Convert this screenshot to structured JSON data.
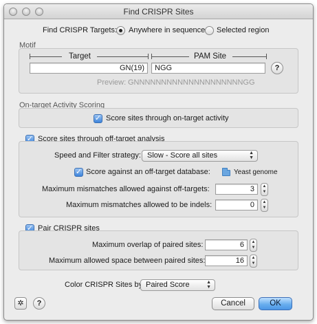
{
  "window": {
    "title": "Find CRISPR Sites"
  },
  "targets": {
    "label": "Find CRISPR Targets:",
    "option_anywhere": "Anywhere in sequence",
    "option_selected": "Selected region",
    "selected": "anywhere"
  },
  "motif": {
    "legend": "Motif",
    "target_header": "Target",
    "pam_header": "PAM Site",
    "target_value": "GN(19)",
    "pam_value": "NGG",
    "preview_label": "Preview:",
    "preview_value": "GNNNNNNNNNNNNNNNNNNNNGG"
  },
  "on_target": {
    "legend": "On-target Activity Scoring",
    "checkbox_label": "Score sites through on-target activity",
    "checked": true
  },
  "off_target": {
    "checkbox_label": "Score sites through off-target analysis",
    "checked": true,
    "strategy_label": "Speed and Filter strategy:",
    "strategy_value": "Slow - Score all sites",
    "database_label": "Score against an off-target database:",
    "database_checked": true,
    "database_value": "Yeast genome",
    "mismatch_label": "Maximum mismatches allowed against off-targets:",
    "mismatch_value": "3",
    "indel_label": "Maximum mismatches allowed to be indels:",
    "indel_value": "0"
  },
  "pair": {
    "checkbox_label": "Pair CRISPR sites",
    "checked": true,
    "overlap_label": "Maximum overlap of paired sites:",
    "overlap_value": "6",
    "space_label": "Maximum allowed space between paired sites:",
    "space_value": "16"
  },
  "color": {
    "label": "Color CRISPR Sites by:",
    "value": "Paired Score"
  },
  "buttons": {
    "cancel": "Cancel",
    "ok": "OK"
  },
  "icons": {
    "help": "?",
    "settings": "gear-icon"
  },
  "accent": "#4b96e6"
}
